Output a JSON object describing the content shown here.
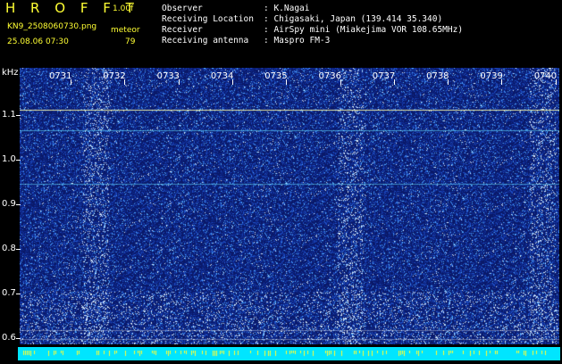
{
  "header": {
    "app_name": "H R O F F T",
    "version": "1.00f",
    "filename": "KN9_2508060730.png",
    "mode": "meteor",
    "count": "79",
    "datetime": "25.08.06 07:30",
    "observer_label": "Observer",
    "observer_value": ": K.Nagai",
    "location_label": "Receiving Location",
    "location_value": ": Chigasaki, Japan (139.414 35.340)",
    "receiver_label": "Receiver",
    "receiver_value": ": AirSpy mini (Miakejima VOR 108.65MHz)",
    "antenna_label": "Receiving antenna",
    "antenna_value": ": Maspro FM-3"
  },
  "axis": {
    "unit": "kHz",
    "times": [
      "0731",
      "0732",
      "0733",
      "0734",
      "0735",
      "0736",
      "0737",
      "0738",
      "0739",
      "0740"
    ],
    "freqs": [
      "1.1",
      "1.0",
      "0.9",
      "0.8",
      "0.7",
      "0.6"
    ]
  },
  "colors": {
    "background": "#0b1a66",
    "carrier": "#ffffaa",
    "echo": "#66e0ff",
    "bottom_band": "#00e5ff"
  }
}
